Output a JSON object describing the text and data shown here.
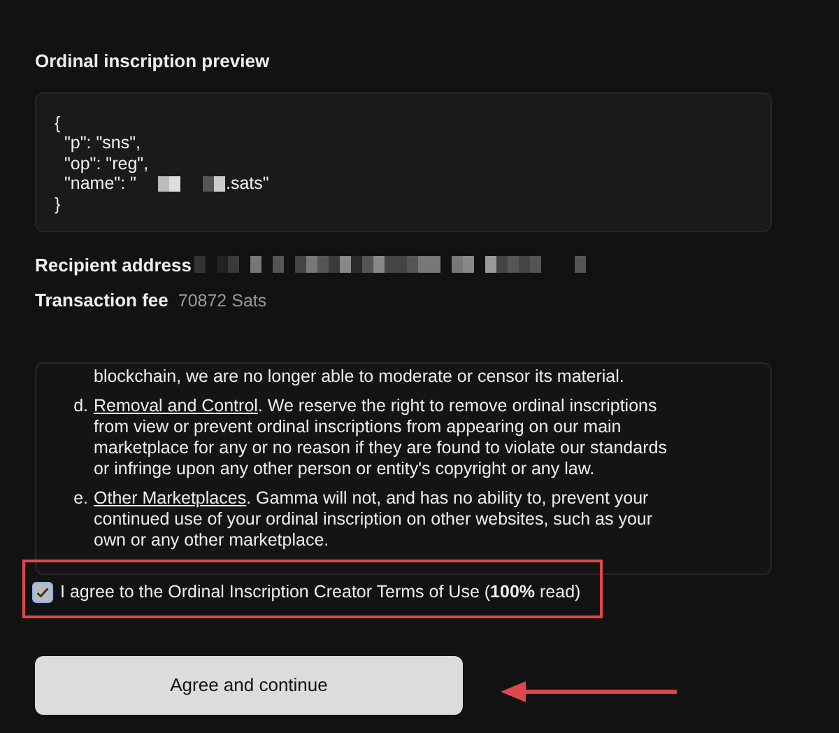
{
  "preview": {
    "title": "Ordinal inscription preview",
    "code_lines": [
      {
        "text": "{"
      },
      {
        "text": "  \"p\": \"sns\","
      },
      {
        "text": "  \"op\": \"reg\","
      },
      {
        "text": "  \"name\": \"",
        "redacted": true,
        "after": ".sats\""
      },
      {
        "text": "}"
      }
    ]
  },
  "recipient": {
    "label": "Recipient address"
  },
  "fee": {
    "label": "Transaction fee",
    "value": "70872 Sats"
  },
  "terms": [
    {
      "kind": "continuation",
      "text": "blockchain, we are no longer able to moderate or censor its material."
    },
    {
      "kind": "item",
      "marker": "d.",
      "title": "Removal and Control",
      "text": ". We reserve the right to remove ordinal inscriptions from view or prevent ordinal inscriptions from appearing on our main marketplace for any or no reason if they are found to violate our standards or infringe upon any other person or entity's copyright or any law."
    },
    {
      "kind": "item",
      "marker": "e.",
      "title": "Other Marketplaces",
      "text": ". Gamma will not, and has no ability to, prevent your continued use of your ordinal inscription on other websites, such as your own or any other marketplace."
    }
  ],
  "agree": {
    "label": "I agree to the Ordinal Inscription Creator Terms of Use (**100%** read)",
    "checked": true
  },
  "button": {
    "label": "Agree and continue"
  }
}
